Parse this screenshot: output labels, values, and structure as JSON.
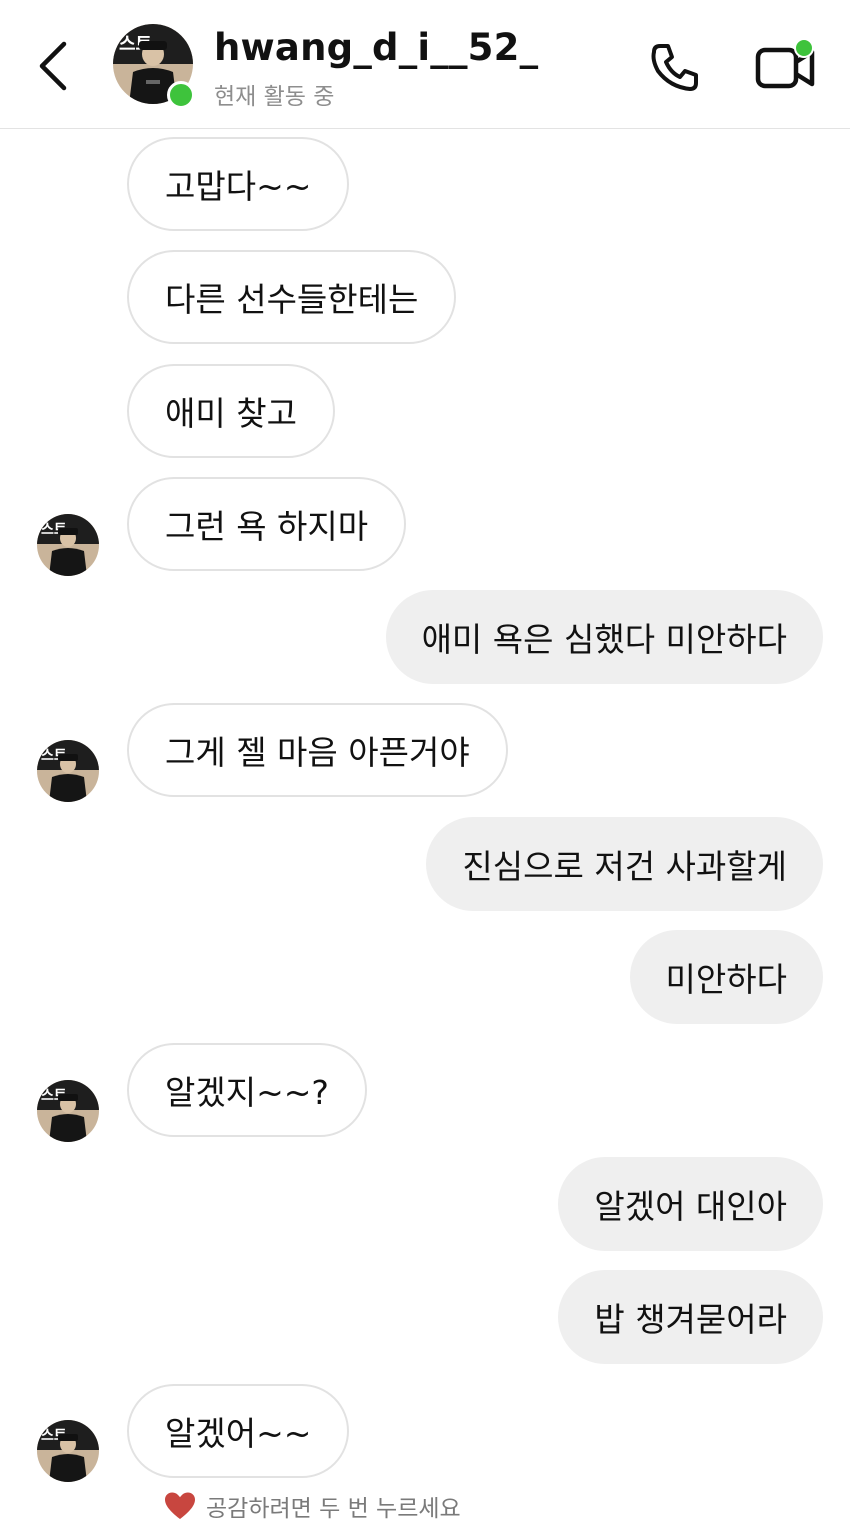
{
  "header": {
    "username": "hwang_d_i__52_",
    "status": "현재 활동 중",
    "online_color": "#3ec33c",
    "icons": [
      "back-chevron-icon",
      "avatar-image",
      "phone-icon",
      "video-call-icon"
    ]
  },
  "messages": [
    {
      "dir": "in",
      "text": "고맙다~~",
      "avatar": false
    },
    {
      "dir": "in",
      "text": "다른 선수들한테는",
      "avatar": false
    },
    {
      "dir": "in",
      "text": "애미 찾고",
      "avatar": false
    },
    {
      "dir": "in",
      "text": "그런 욕 하지마",
      "avatar": true
    },
    {
      "dir": "out",
      "text": "애미 욕은 심했다 미안하다"
    },
    {
      "dir": "in",
      "text": "그게 젤 마음 아픈거야",
      "avatar": true
    },
    {
      "dir": "out",
      "text": "진심으로 저건 사과할게"
    },
    {
      "dir": "out",
      "text": "미안하다"
    },
    {
      "dir": "in",
      "text": "알겠지~~?",
      "avatar": true
    },
    {
      "dir": "out",
      "text": "알겠어 대인아"
    },
    {
      "dir": "out",
      "text": "밥 챙겨묻어라"
    },
    {
      "dir": "in",
      "text": "알겠어~~",
      "avatar": true
    }
  ],
  "reaction_hint": {
    "text": "공감하려면 두 번 누르세요",
    "icon": "heart-icon",
    "color": "#c8463f"
  },
  "colors": {
    "incoming_border": "#e2e2e2",
    "outgoing_bg": "#efefef",
    "secondary_text": "#8e8e8e"
  }
}
